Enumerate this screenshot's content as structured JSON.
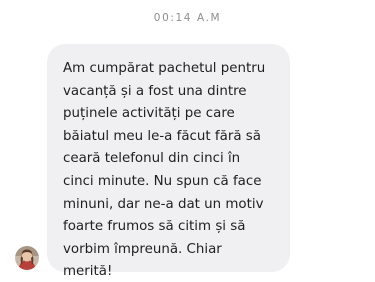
{
  "conversation": {
    "timestamp": "00:14 A.M",
    "message": {
      "sender_avatar": "user-avatar",
      "text": "Am cumpărat pachetul pentru\nvacanță și a fost una dintre\npuținele activități pe care\nbăiatul meu le-a făcut fără să\nceară telefonul din cinci în\ncinci minute. Nu spun că face\nminuni, dar ne-a dat un motiv\nfoarte frumos să citim și să\nvorbim împreună. Chiar\nmerită!",
      "bubble_color": "#f0f0f2",
      "text_color": "#1f1f1f"
    }
  }
}
